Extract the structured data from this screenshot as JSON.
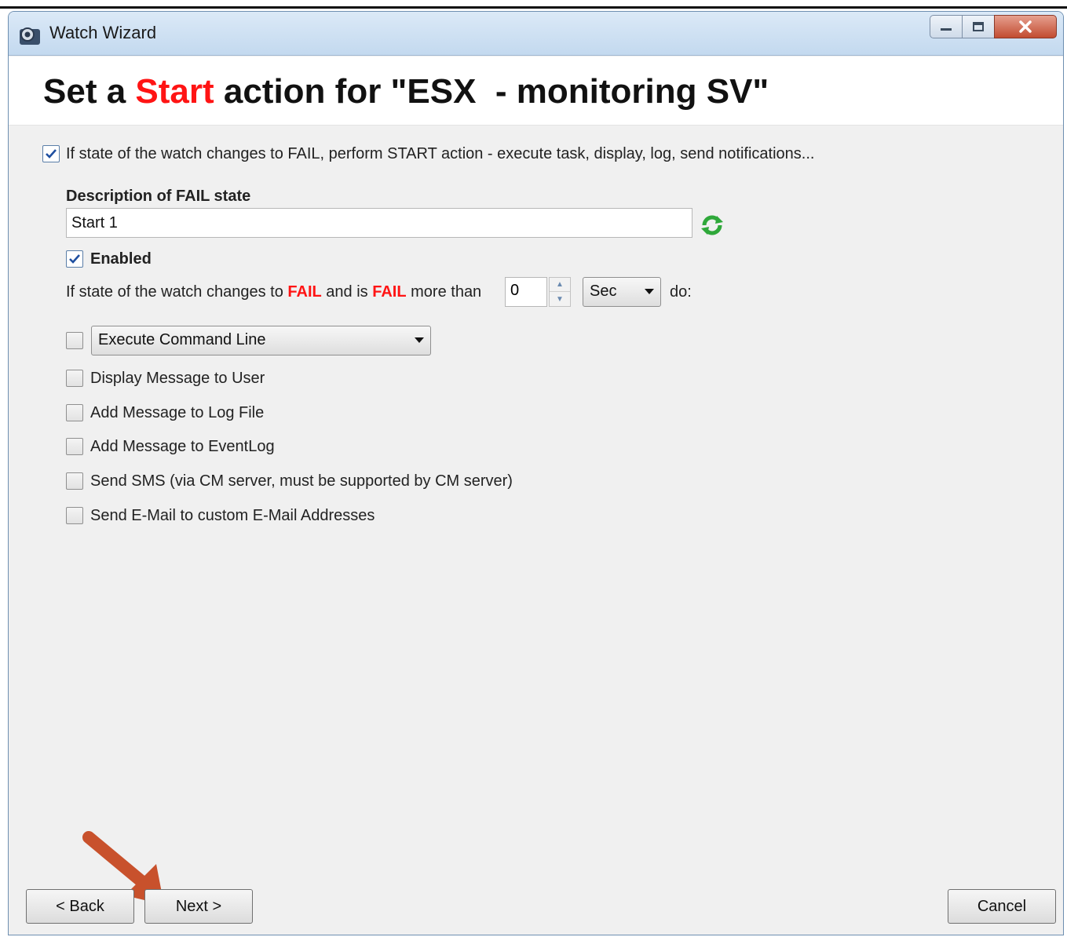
{
  "window": {
    "title": "Watch Wizard"
  },
  "header": {
    "title_prefix": "Set a ",
    "title_highlight": "Start",
    "title_suffix": " action for \"ESX  - monitoring SV\""
  },
  "main": {
    "perform_checkbox": {
      "checked": true,
      "label": "If state of the watch changes to FAIL, perform START action - execute task, display, log, send notifications..."
    },
    "description_label": "Description of FAIL state",
    "description_value": "Start 1",
    "enabled_checkbox": {
      "checked": true,
      "label": "Enabled"
    },
    "condition": {
      "part1": "If state of the watch changes to ",
      "fail1": "FAIL",
      "part2": " and is ",
      "fail2": "FAIL",
      "part3": " more than",
      "delay_value": "0",
      "unit_selected": "Sec",
      "part4": "do:"
    },
    "actions": [
      {
        "label": "Execute Command Line",
        "checked": false,
        "type": "dropdown"
      },
      {
        "label": "Display Message to User",
        "checked": false
      },
      {
        "label": "Add Message to Log File",
        "checked": false
      },
      {
        "label": "Add Message to EventLog",
        "checked": false
      },
      {
        "label": "Send SMS (via CM server, must be supported by CM server)",
        "checked": false
      },
      {
        "label": "Send E-Mail to custom E-Mail Addresses",
        "checked": false
      }
    ]
  },
  "footer": {
    "back_label": "< Back",
    "next_label": "Next >",
    "cancel_label": "Cancel"
  },
  "colors": {
    "highlight_red": "#ff1414",
    "annotation_arrow": "#c8512c",
    "refresh_icon_green": "#2fa83a"
  }
}
